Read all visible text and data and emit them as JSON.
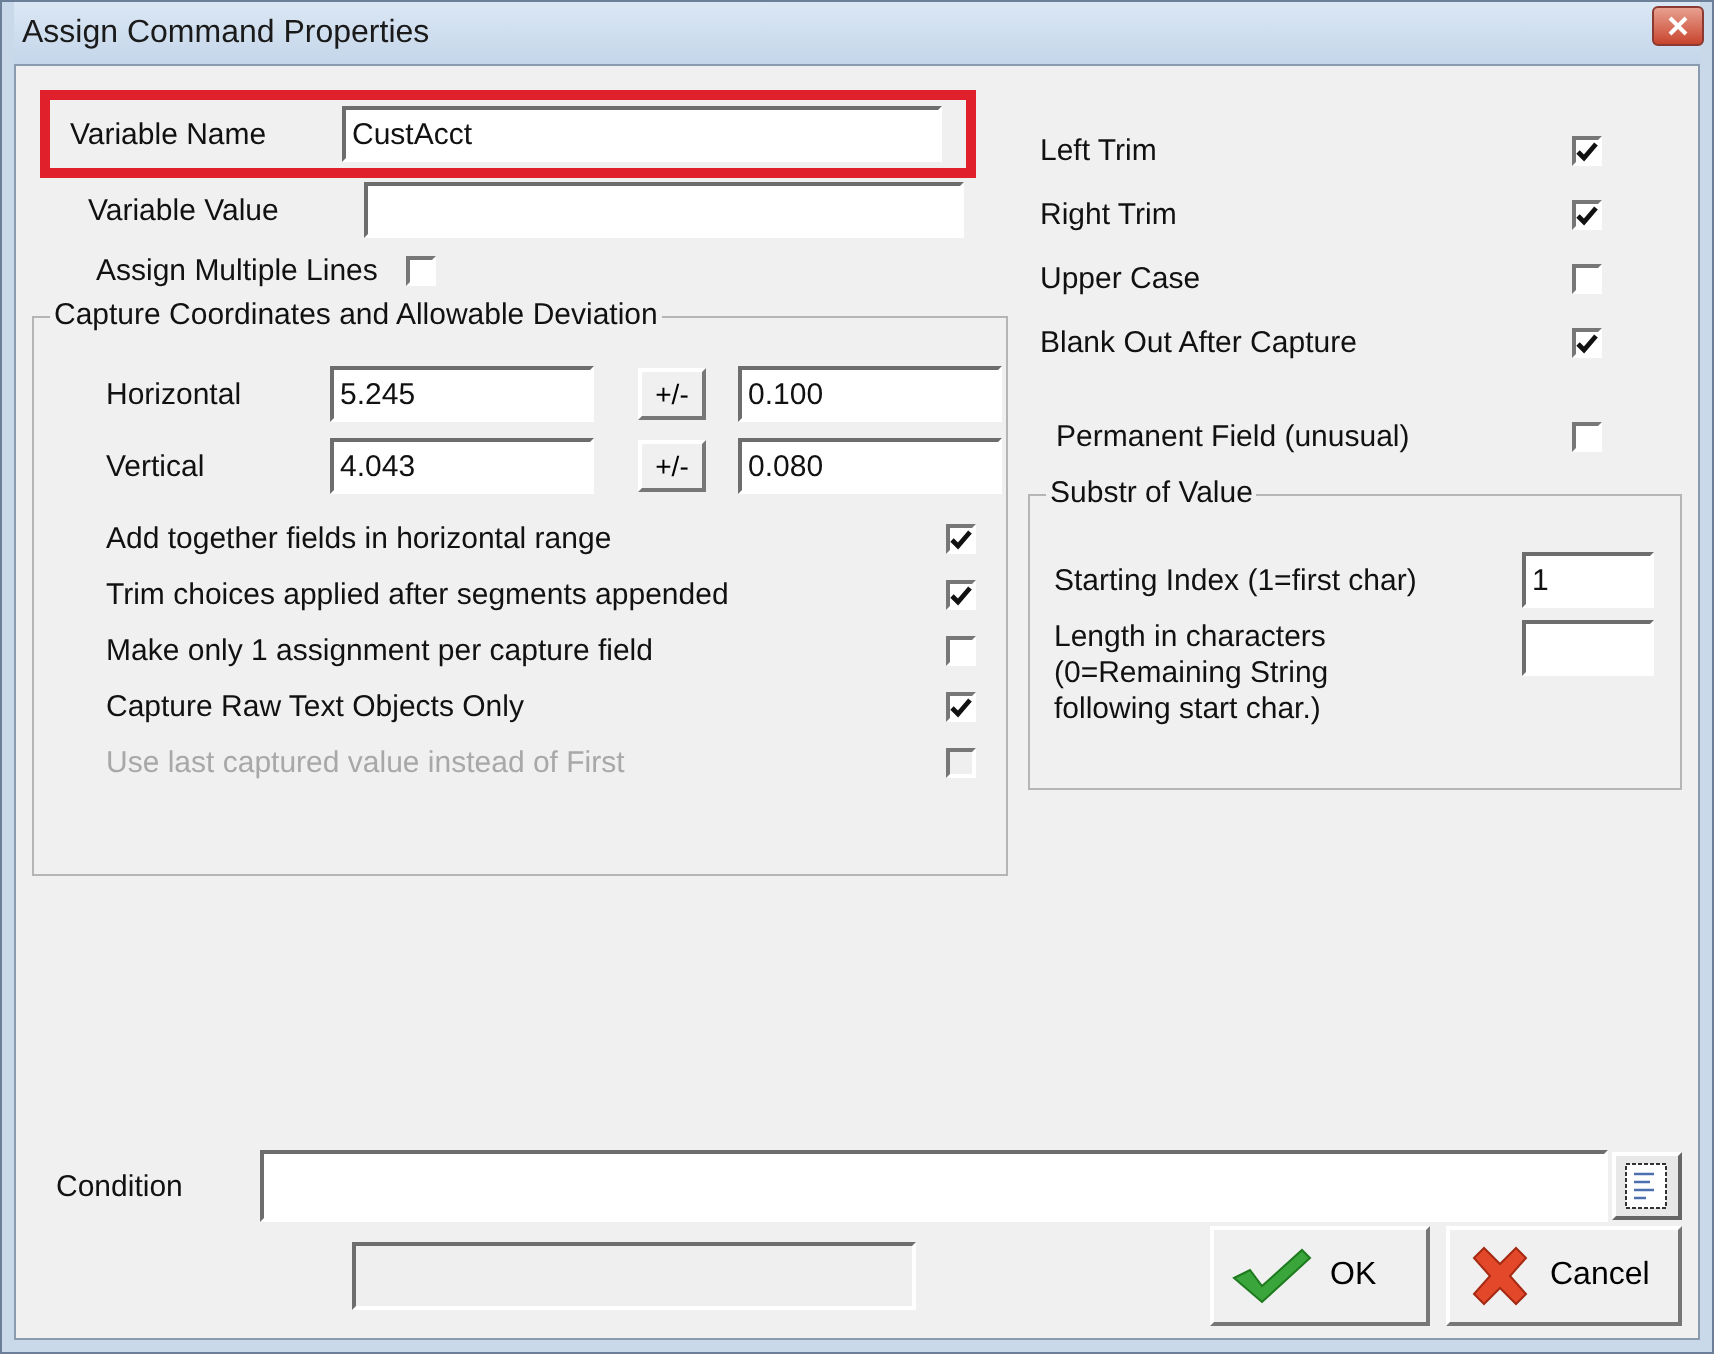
{
  "window": {
    "title": "Assign Command Properties"
  },
  "variable_name": {
    "label": "Variable Name",
    "value": "CustAcct",
    "highlighted": true
  },
  "variable_value": {
    "label": "Variable Value"
  },
  "assign_multiple_lines": {
    "label": "Assign Multiple Lines",
    "checked": false
  },
  "capture_group": {
    "title": "Capture Coordinates and Allowable Deviation",
    "coordinates": [
      {
        "label": "Horizontal",
        "value": "5.245",
        "button": "+/-",
        "deviation": "0.100"
      },
      {
        "label": "Vertical",
        "value": "4.043",
        "button": "+/-",
        "deviation": "0.080"
      }
    ],
    "options": [
      {
        "label": "Add together fields in horizontal range",
        "checked": true,
        "disabled": false
      },
      {
        "label": "Trim choices applied after segments appended",
        "checked": true,
        "disabled": false
      },
      {
        "label": "Make only 1 assignment per capture field",
        "checked": false,
        "disabled": false
      },
      {
        "label": "Capture Raw Text Objects Only",
        "checked": true,
        "disabled": false
      },
      {
        "label": "Use last captured value instead of First",
        "checked": false,
        "disabled": true
      }
    ]
  },
  "trim_options": [
    {
      "label": "Left Trim",
      "checked": true
    },
    {
      "label": "Right Trim",
      "checked": true
    },
    {
      "label": "Upper Case",
      "checked": false
    },
    {
      "label": "Blank Out After Capture",
      "checked": true
    }
  ],
  "permanent_field": {
    "label": "Permanent Field (unusual)",
    "checked": false
  },
  "substr_group": {
    "title": "Substr of Value",
    "starting_index": {
      "label": "Starting Index (1=first char)",
      "value": "1"
    },
    "length": {
      "label": "Length in characters\n(0=Remaining String\nfollowing start char.)"
    }
  },
  "condition": {
    "label": "Condition"
  },
  "buttons": [
    {
      "kind": "ok",
      "label": "OK"
    },
    {
      "kind": "cancel",
      "label": "Cancel"
    }
  ]
}
